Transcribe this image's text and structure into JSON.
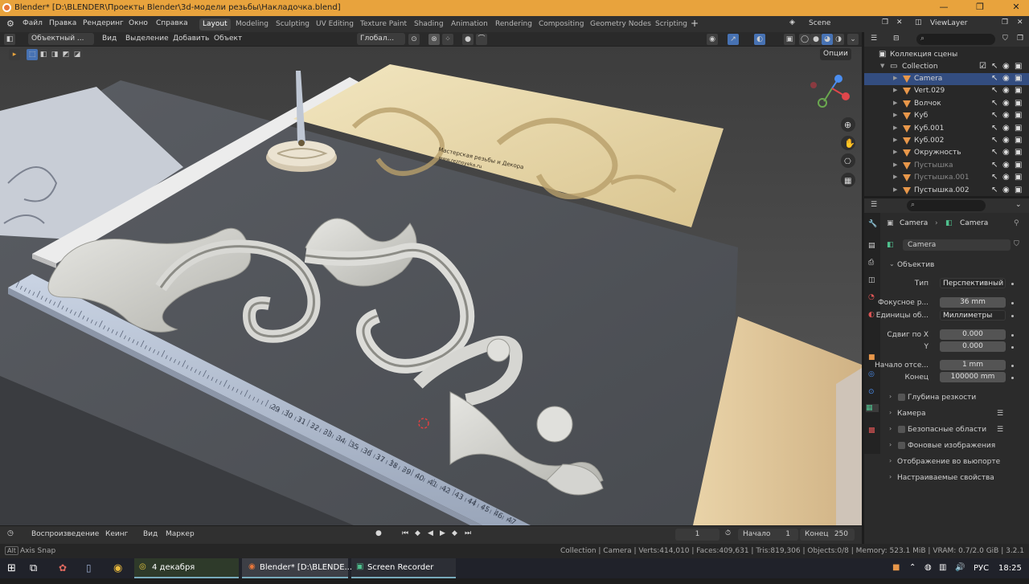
{
  "titlebar": {
    "title": "Blender* [D:\\BLENDER\\Проекты Blender\\3d-модели резьбы\\Накладочка.blend]"
  },
  "menu": [
    "Файл",
    "Правка",
    "Рендеринг",
    "Окно",
    "Справка"
  ],
  "workspaces": [
    "Layout",
    "Modeling",
    "Sculpting",
    "UV Editing",
    "Texture Paint",
    "Shading",
    "Animation",
    "Rendering",
    "Compositing",
    "Geometry Nodes",
    "Scripting"
  ],
  "active_workspace": "Layout",
  "scene": {
    "name": "Scene",
    "view_layer": "ViewLayer"
  },
  "viewport_header": {
    "mode": "Объектный ...",
    "items": [
      "Вид",
      "Выделение",
      "Добавить",
      "Объект"
    ],
    "transform": "Глобал...",
    "options": "Опции"
  },
  "viewport_scene": {
    "sign_text": "Мастерская резьбы и Декора",
    "sign_url": "www.reznoyeka.ru",
    "ruler_numbers": [
      "29",
      "30",
      "31",
      "32",
      "33",
      "34",
      "35",
      "36",
      "37",
      "38",
      "39",
      "40",
      "41",
      "42",
      "43",
      "44",
      "45",
      "46",
      "47"
    ]
  },
  "outliner": {
    "collection_label": "Коллекция сцены",
    "collection": "Collection",
    "items": [
      {
        "name": "Camera",
        "selected": true,
        "dim": false
      },
      {
        "name": "Vert.029",
        "selected": false,
        "dim": false
      },
      {
        "name": "Волчок",
        "selected": false,
        "dim": false
      },
      {
        "name": "Куб",
        "selected": false,
        "dim": false
      },
      {
        "name": "Куб.001",
        "selected": false,
        "dim": false
      },
      {
        "name": "Куб.002",
        "selected": false,
        "dim": false
      },
      {
        "name": "Окружность",
        "selected": false,
        "dim": false
      },
      {
        "name": "Пустышка",
        "selected": false,
        "dim": true
      },
      {
        "name": "Пустышка.001",
        "selected": false,
        "dim": true
      },
      {
        "name": "Пустышка.002",
        "selected": false,
        "dim": false
      }
    ]
  },
  "properties": {
    "breadcrumb_obj": "Camera",
    "breadcrumb_data": "Camera",
    "datablock": "Camera",
    "section_lens": "Объектив",
    "type_label": "Тип",
    "type_value": "Перспективный",
    "focal_label": "Фокусное р...",
    "focal_value": "36 mm",
    "units_label": "Единицы об...",
    "units_value": "Миллиметры",
    "shiftx_label": "Сдвиг по X",
    "shiftx_value": "0.000",
    "shifty_label": "Y",
    "shifty_value": "0.000",
    "clipstart_label": "Начало отсе...",
    "clipstart_value": "1 mm",
    "clipend_label": "Конец",
    "clipend_value": "100000 mm",
    "sections": [
      {
        "label": "Глубина резкости",
        "checkbox": true,
        "list": false
      },
      {
        "label": "Камера",
        "checkbox": false,
        "list": true
      },
      {
        "label": "Безопасные области",
        "checkbox": true,
        "list": true
      },
      {
        "label": "Фоновые изображения",
        "checkbox": true,
        "list": false
      },
      {
        "label": "Отображение во вьюпорте",
        "checkbox": false,
        "list": false
      },
      {
        "label": "Настраиваемые свойства",
        "checkbox": false,
        "list": false
      }
    ]
  },
  "timeline": {
    "playback": "Воспроизведение",
    "keying": "Кеинг",
    "view": "Вид",
    "marker": "Маркер",
    "current_frame": "1",
    "start_label": "Начало",
    "start": "1",
    "end_label": "Конец",
    "end": "250"
  },
  "statusbar": {
    "left_key": "Alt",
    "left_action": "Axis Snap",
    "stats": "Collection | Camera | Verts:414,010 | Faces:409,631 | Tris:819,306 | Objects:0/8 | Memory: 523.1 MiB | VRAM: 0.7/2.0 GiB | 3.2.1"
  },
  "taskbar": {
    "date_app": "4 декабря",
    "blender_task": "Blender* [D:\\BLENDE...",
    "recorder": "Screen Recorder",
    "lang": "РУС",
    "time": "18:25"
  },
  "colors": {
    "accent": "#e8a33d",
    "selection": "#334d80",
    "viewport_bg": "#4b4b4b"
  }
}
